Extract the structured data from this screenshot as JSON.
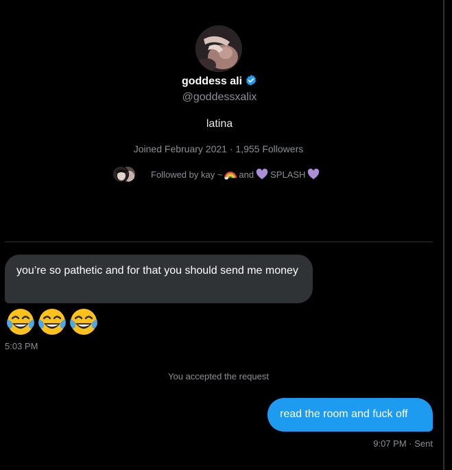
{
  "profile": {
    "display_name": "goddess ali",
    "handle": "@goddessxalix",
    "bio": "latina",
    "joined": "Joined February 2021",
    "separator": "·",
    "followers": "1,955 Followers",
    "followed_by_prefix": "Followed by kay ~",
    "followed_by_and": "and",
    "followed_by_second": "SPLASH",
    "verified_icon": "verified-badge-icon",
    "verified_color": "#1d9bf0"
  },
  "messages": [
    {
      "direction": "incoming",
      "text": "you’re so pathetic and for that you should send me money",
      "emojis": [
        "face-with-tears-of-joy",
        "face-with-tears-of-joy",
        "face-with-tears-of-joy"
      ],
      "time": "5:03 PM"
    },
    {
      "direction": "system",
      "text": "You accepted the request"
    },
    {
      "direction": "outgoing",
      "text": "read the room and fuck off",
      "time": "9:07 PM",
      "status": "Sent"
    }
  ],
  "colors": {
    "background": "#000000",
    "incoming_bubble": "#2f3336",
    "outgoing_bubble": "#1d9bf0",
    "muted_text": "#8b8f93",
    "heart_purple": "#aa8ed6"
  }
}
